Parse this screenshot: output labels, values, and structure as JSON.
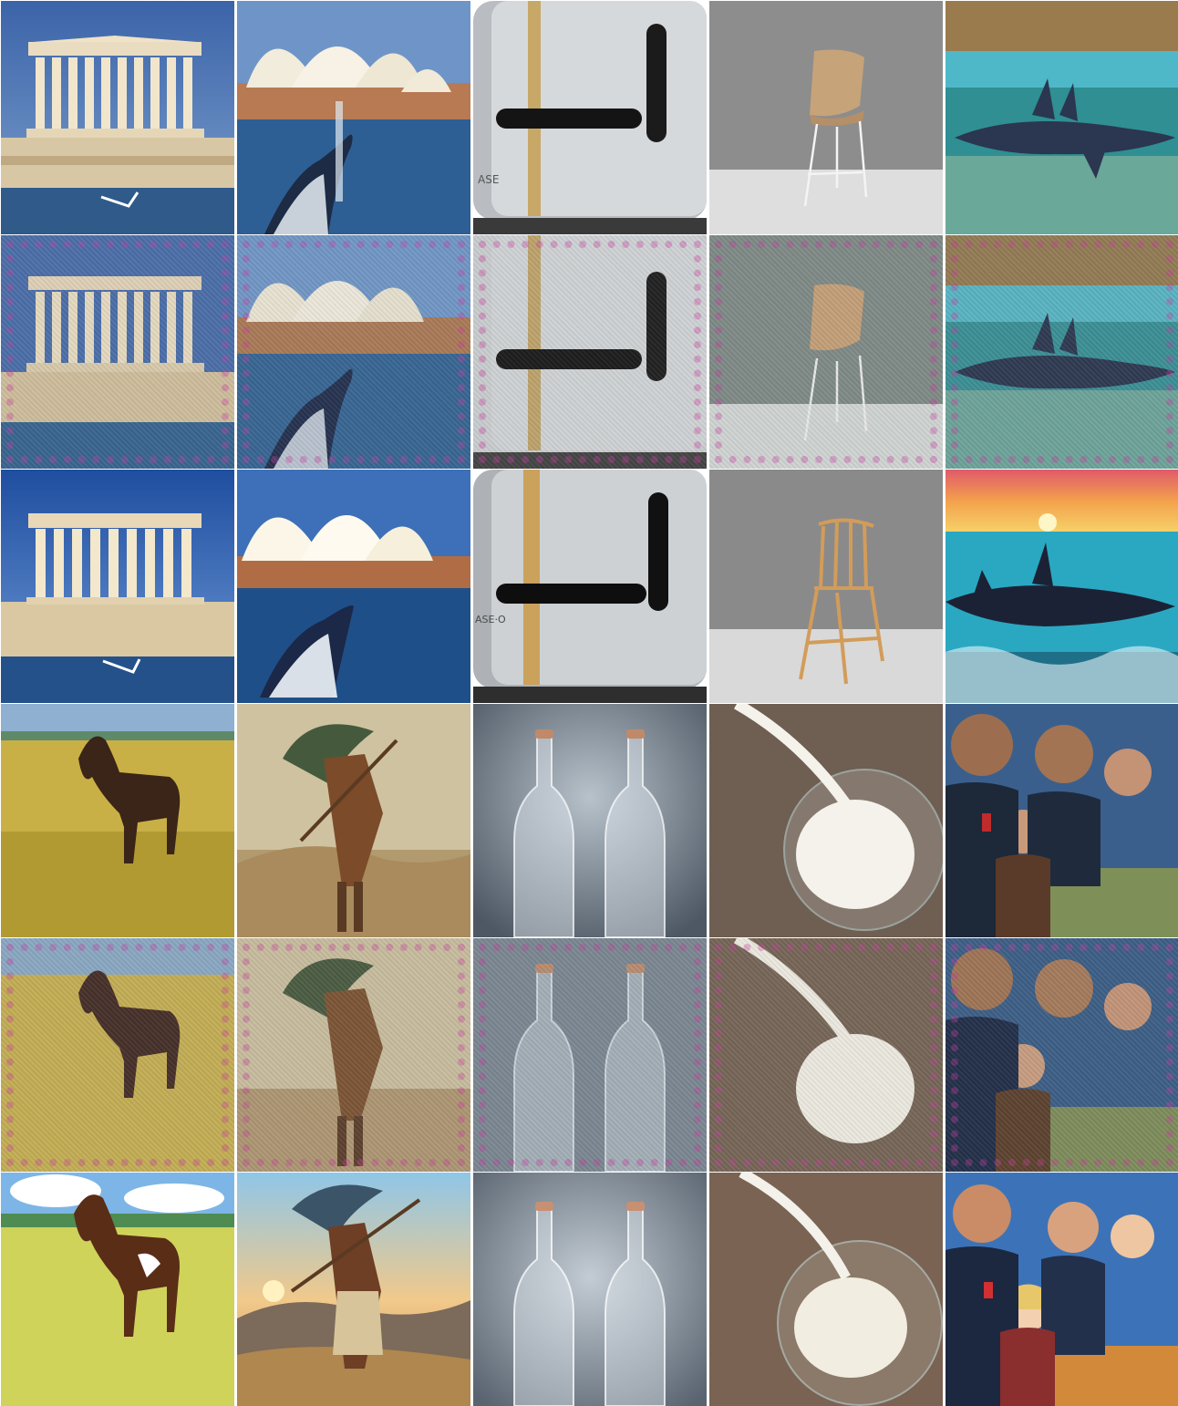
{
  "grid": {
    "rows": 6,
    "cols": 5
  },
  "tiles": [
    {
      "row": 0,
      "col": 0,
      "subject": "parthenon-coast",
      "variant": "original"
    },
    {
      "row": 0,
      "col": 1,
      "subject": "sydney-opera-whale",
      "variant": "original"
    },
    {
      "row": 0,
      "col": 2,
      "subject": "steel-toaster",
      "variant": "original"
    },
    {
      "row": 0,
      "col": 3,
      "subject": "wooden-chair",
      "variant": "original"
    },
    {
      "row": 0,
      "col": 4,
      "subject": "shark-underwater",
      "variant": "original"
    },
    {
      "row": 1,
      "col": 0,
      "subject": "parthenon-coast",
      "variant": "reconstruction"
    },
    {
      "row": 1,
      "col": 1,
      "subject": "sydney-opera-whale",
      "variant": "reconstruction"
    },
    {
      "row": 1,
      "col": 2,
      "subject": "steel-toaster",
      "variant": "reconstruction"
    },
    {
      "row": 1,
      "col": 3,
      "subject": "wooden-chair",
      "variant": "reconstruction"
    },
    {
      "row": 1,
      "col": 4,
      "subject": "shark-underwater",
      "variant": "reconstruction"
    },
    {
      "row": 2,
      "col": 0,
      "subject": "parthenon-coast",
      "variant": "generated"
    },
    {
      "row": 2,
      "col": 1,
      "subject": "sydney-opera-whale",
      "variant": "generated"
    },
    {
      "row": 2,
      "col": 2,
      "subject": "steel-toaster",
      "variant": "generated"
    },
    {
      "row": 2,
      "col": 3,
      "subject": "wooden-chair",
      "variant": "generated"
    },
    {
      "row": 2,
      "col": 4,
      "subject": "shark-sunset",
      "variant": "generated"
    },
    {
      "row": 3,
      "col": 0,
      "subject": "horse-meadow",
      "variant": "original"
    },
    {
      "row": 3,
      "col": 1,
      "subject": "wanderer-painting",
      "variant": "original"
    },
    {
      "row": 3,
      "col": 2,
      "subject": "glass-bottles",
      "variant": "original"
    },
    {
      "row": 3,
      "col": 3,
      "subject": "milk-pour",
      "variant": "original"
    },
    {
      "row": 3,
      "col": 4,
      "subject": "warriors-poster",
      "variant": "original"
    },
    {
      "row": 4,
      "col": 0,
      "subject": "horse-meadow",
      "variant": "reconstruction"
    },
    {
      "row": 4,
      "col": 1,
      "subject": "wanderer-painting",
      "variant": "reconstruction"
    },
    {
      "row": 4,
      "col": 2,
      "subject": "glass-bottles",
      "variant": "reconstruction"
    },
    {
      "row": 4,
      "col": 3,
      "subject": "milk-pour",
      "variant": "reconstruction"
    },
    {
      "row": 4,
      "col": 4,
      "subject": "warriors-poster",
      "variant": "reconstruction"
    },
    {
      "row": 5,
      "col": 0,
      "subject": "horse-anime",
      "variant": "generated"
    },
    {
      "row": 5,
      "col": 1,
      "subject": "wanderer-anime",
      "variant": "generated"
    },
    {
      "row": 5,
      "col": 2,
      "subject": "glass-bottles",
      "variant": "generated"
    },
    {
      "row": 5,
      "col": 3,
      "subject": "milk-pour",
      "variant": "generated"
    },
    {
      "row": 5,
      "col": 4,
      "subject": "warriors-anime",
      "variant": "generated"
    }
  ],
  "printed_text": {
    "toaster_brand": "ASE",
    "toaster_brand_generated": "ASE·O"
  }
}
